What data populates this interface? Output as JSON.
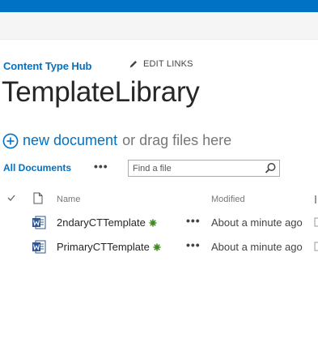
{
  "breadcrumb": {
    "site_link": "Content Type Hub",
    "edit_links": "EDIT LINKS"
  },
  "page": {
    "title": "TemplateLibrary"
  },
  "new_document": {
    "link_text": "new document",
    "drag_text": "or drag files here"
  },
  "views": {
    "current_view": "All Documents",
    "more": "•••",
    "search_placeholder": "Find a file"
  },
  "list": {
    "columns": {
      "name": "Name",
      "modified": "Modified"
    },
    "items": [
      {
        "name": "2ndaryCTTemplate",
        "more": "•••",
        "modified": "About a minute ago"
      },
      {
        "name": "PrimaryCTTemplate",
        "more": "•••",
        "modified": "About a minute ago"
      }
    ]
  },
  "colors": {
    "suite_bar": "#0072c6",
    "link": "#0072c6",
    "new_marker": "#3d8b1f",
    "word_icon": "#2b579a"
  },
  "icons": [
    "pencil-icon",
    "plus-circle-icon",
    "search-icon",
    "checkmark-icon",
    "document-icon",
    "word-icon",
    "new-item-icon"
  ]
}
